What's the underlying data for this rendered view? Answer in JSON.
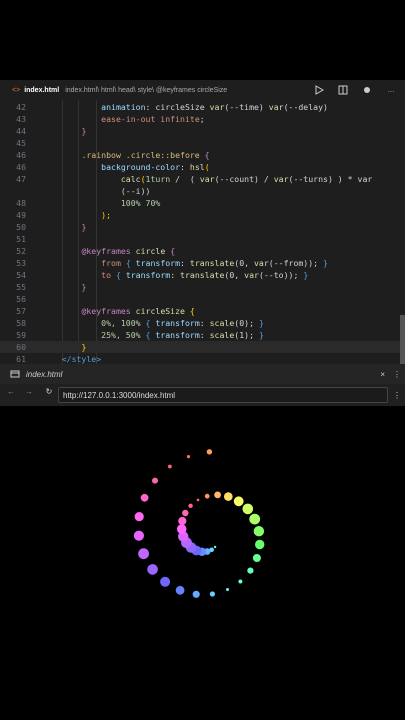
{
  "tabbar": {
    "filename": "index.html",
    "breadcrumbs": "index.html\\ html\\ head\\ style\\ @keyframes circleSize",
    "actions": [
      "play-icon",
      "split-icon",
      "circle-dot-icon",
      "more-icon"
    ]
  },
  "code": {
    "lines": [
      {
        "n": "42",
        "parts": [
          [
            "            ",
            "w"
          ],
          [
            "animation",
            "p"
          ],
          [
            ": ",
            "w"
          ],
          [
            "circleSize ",
            "w"
          ],
          [
            "var",
            "f"
          ],
          [
            "(--time) ",
            "w"
          ],
          [
            "var",
            "f"
          ],
          [
            "(--delay)",
            "w"
          ]
        ]
      },
      {
        "n": "43",
        "parts": [
          [
            "            ",
            "w"
          ],
          [
            "ease-in-out infinite",
            "v"
          ],
          [
            ";",
            "w"
          ]
        ]
      },
      {
        "n": "44",
        "parts": [
          [
            "        ",
            "w"
          ],
          [
            "}",
            "k"
          ]
        ]
      },
      {
        "n": "45",
        "parts": [
          [
            "",
            "w"
          ]
        ]
      },
      {
        "n": "46",
        "parts": [
          [
            "        ",
            "w"
          ],
          [
            ".rainbow .circle::before ",
            "s"
          ],
          [
            "{",
            "k"
          ]
        ]
      },
      {
        "n": "46",
        "parts": [
          [
            "            ",
            "w"
          ],
          [
            "background-color",
            "p"
          ],
          [
            ": ",
            "w"
          ],
          [
            "hsl",
            "f"
          ],
          [
            "(",
            "d"
          ]
        ]
      },
      {
        "n": "47",
        "parts": [
          [
            "                ",
            "w"
          ],
          [
            "calc",
            "f"
          ],
          [
            "(",
            "d"
          ],
          [
            "1turn ",
            "n"
          ],
          [
            "/  ( ",
            "w"
          ],
          [
            "var",
            "f"
          ],
          [
            "(--count) / ",
            "w"
          ],
          [
            "var",
            "f"
          ],
          [
            "(--turns) ) * var",
            "w"
          ]
        ]
      },
      {
        "n": "",
        "parts": [
          [
            "                ",
            "w"
          ],
          [
            "(--i))",
            "w"
          ]
        ]
      },
      {
        "n": "48",
        "parts": [
          [
            "                ",
            "w"
          ],
          [
            "100% 70%",
            "n"
          ]
        ]
      },
      {
        "n": "49",
        "parts": [
          [
            "            ",
            "w"
          ],
          [
            ");",
            "d"
          ]
        ]
      },
      {
        "n": "50",
        "parts": [
          [
            "        ",
            "w"
          ],
          [
            "}",
            "k"
          ]
        ]
      },
      {
        "n": "51",
        "parts": [
          [
            "",
            "w"
          ]
        ]
      },
      {
        "n": "52",
        "parts": [
          [
            "        ",
            "w"
          ],
          [
            "@keyframes ",
            "k"
          ],
          [
            "circle ",
            "f"
          ],
          [
            "{",
            "k"
          ]
        ]
      },
      {
        "n": "53",
        "parts": [
          [
            "            ",
            "w"
          ],
          [
            "from ",
            "v"
          ],
          [
            "{ ",
            "t"
          ],
          [
            "transform",
            "p"
          ],
          [
            ": ",
            "w"
          ],
          [
            "translate",
            "f"
          ],
          [
            "(0, ",
            "w"
          ],
          [
            "var",
            "f"
          ],
          [
            "(--from)); ",
            "w"
          ],
          [
            "}",
            "t"
          ]
        ]
      },
      {
        "n": "54",
        "parts": [
          [
            "            ",
            "w"
          ],
          [
            "to ",
            "v"
          ],
          [
            "{ ",
            "t"
          ],
          [
            "transform",
            "p"
          ],
          [
            ": ",
            "w"
          ],
          [
            "translate",
            "f"
          ],
          [
            "(0, ",
            "w"
          ],
          [
            "var",
            "f"
          ],
          [
            "(--to)); ",
            "w"
          ],
          [
            "}",
            "t"
          ]
        ]
      },
      {
        "n": "55",
        "parts": [
          [
            "        ",
            "w"
          ],
          [
            "}",
            "k"
          ]
        ]
      },
      {
        "n": "56",
        "parts": [
          [
            "",
            "w"
          ]
        ]
      },
      {
        "n": "57",
        "parts": [
          [
            "        ",
            "w"
          ],
          [
            "@keyframes ",
            "k"
          ],
          [
            "circleSize ",
            "f"
          ],
          [
            "{",
            "y"
          ]
        ]
      },
      {
        "n": "58",
        "parts": [
          [
            "            ",
            "w"
          ],
          [
            "0%, 100% ",
            "n"
          ],
          [
            "{ ",
            "t"
          ],
          [
            "transform",
            "p"
          ],
          [
            ": ",
            "w"
          ],
          [
            "scale",
            "f"
          ],
          [
            "(0); ",
            "w"
          ],
          [
            "}",
            "t"
          ]
        ]
      },
      {
        "n": "59",
        "parts": [
          [
            "            ",
            "w"
          ],
          [
            "25%, 50% ",
            "n"
          ],
          [
            "{ ",
            "t"
          ],
          [
            "transform",
            "p"
          ],
          [
            ": ",
            "w"
          ],
          [
            "scale",
            "f"
          ],
          [
            "(1); ",
            "w"
          ],
          [
            "}",
            "t"
          ]
        ]
      },
      {
        "n": "60",
        "parts": [
          [
            "        ",
            "w"
          ],
          [
            "}",
            "y"
          ]
        ]
      },
      {
        "n": "61",
        "parts": [
          [
            "    ",
            "w"
          ],
          [
            "</",
            "t"
          ],
          [
            "style",
            "t"
          ],
          [
            ">",
            "t"
          ]
        ]
      }
    ]
  },
  "preview": {
    "tab_title": "index.html",
    "close": "×",
    "url": "http://127.0.0.1:3000/index.html"
  },
  "colors": {
    "editor_bg": "#1e1e1e",
    "page_bg": "#000000"
  }
}
